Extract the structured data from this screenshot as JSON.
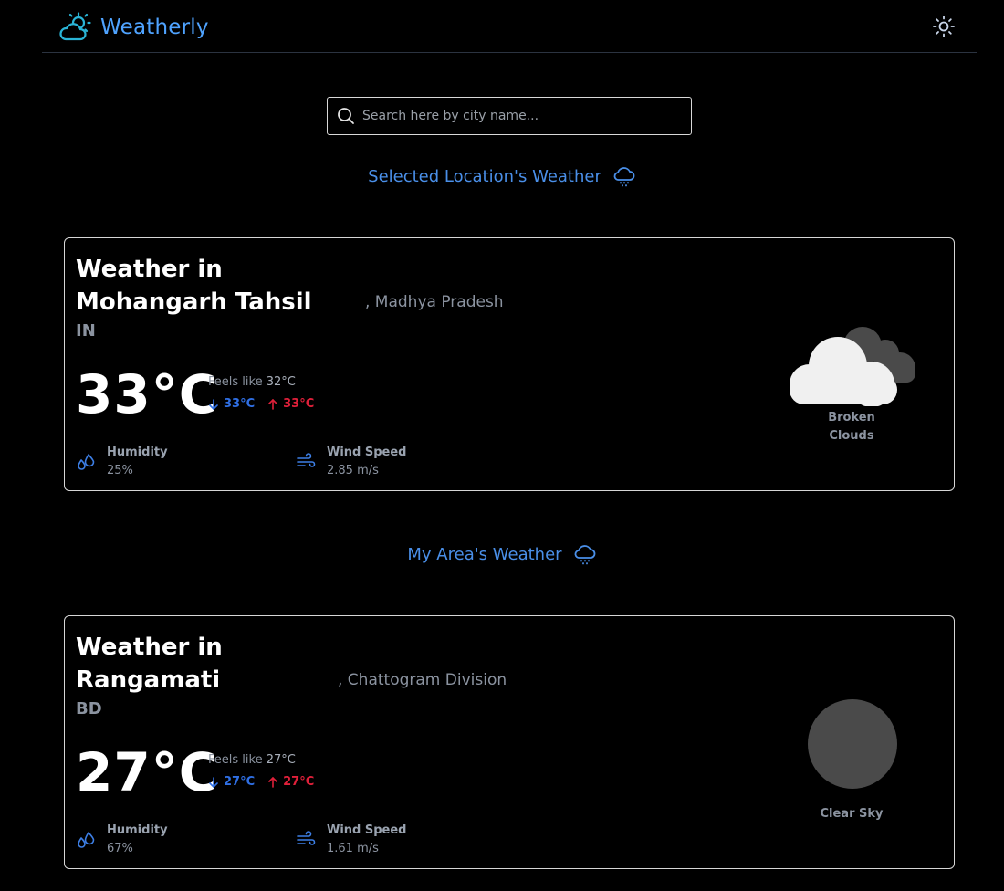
{
  "app": {
    "name": "Weatherly",
    "logo_icon": "cloud-sun-icon",
    "theme_icon": "sun-icon"
  },
  "search": {
    "placeholder": "Search here by city name...",
    "value": "",
    "icon": "search-icon"
  },
  "sections": {
    "selected_title": "Selected Location's Weather",
    "my_area_title": "My Area's Weather",
    "icon": "cloud-rain-icon"
  },
  "selected": {
    "title_line1": "Weather in",
    "title_line2": "Mohangarh Tahsil",
    "region": ", Madhya Pradesh",
    "country": "IN",
    "temp": "33°C",
    "feels_label": "Feels like",
    "feels_value": "32°C",
    "min": "33°C",
    "max": "33°C",
    "humidity_label": "Humidity",
    "humidity_value": "25%",
    "wind_label": "Wind Speed",
    "wind_value": "2.85 m/s",
    "condition_line1": "Broken",
    "condition_line2": "Clouds",
    "condition_icon": "broken-clouds-icon"
  },
  "my_area": {
    "title_line1": "Weather in",
    "title_line2": "Rangamati",
    "region": ", Chattogram Division",
    "country": "BD",
    "temp": "27°C",
    "feels_label": "Feels like",
    "feels_value": "27°C",
    "min": "27°C",
    "max": "27°C",
    "humidity_label": "Humidity",
    "humidity_value": "67%",
    "wind_label": "Wind Speed",
    "wind_value": "1.61 m/s",
    "condition": "Clear Sky",
    "condition_icon": "clear-sky-icon"
  },
  "colors": {
    "accent": "#4fa3ff",
    "section_title": "#4a8fe8",
    "min_temp": "#2f6fe4",
    "max_temp": "#e0203a",
    "muted": "#8b93a0",
    "background": "#000000"
  }
}
